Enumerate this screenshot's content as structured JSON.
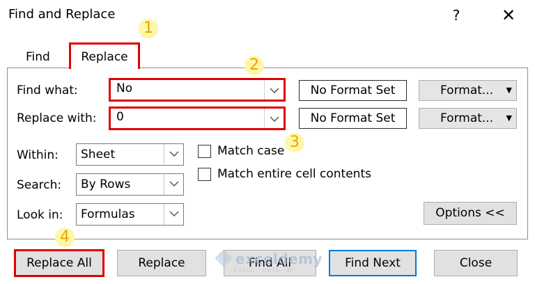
{
  "window": {
    "title": "Find and Replace",
    "help_glyph": "?",
    "close_glyph": "✕"
  },
  "tabs": [
    {
      "label": "Find"
    },
    {
      "label": "Replace"
    }
  ],
  "find_what": {
    "label": "Find what:",
    "value": "No",
    "format_status": "No Format Set",
    "format_button": "Format..."
  },
  "replace_with": {
    "label": "Replace with:",
    "value": "0",
    "format_status": "No Format Set",
    "format_button": "Format..."
  },
  "within": {
    "label": "Within:",
    "value": "Sheet"
  },
  "search": {
    "label": "Search:",
    "value": "By Rows"
  },
  "look_in": {
    "label": "Look in:",
    "value": "Formulas"
  },
  "options": {
    "match_case": {
      "label": "Match case",
      "checked": false
    },
    "match_entire": {
      "label": "Match entire cell contents",
      "checked": false
    },
    "options_button": "Options <<"
  },
  "buttons": {
    "replace_all": "Replace All",
    "replace": "Replace",
    "find_all": "Find All",
    "find_next": "Find Next",
    "close": "Close"
  },
  "annotations": [
    "1",
    "2",
    "3",
    "4"
  ],
  "watermark": {
    "name": "exceldemy",
    "tagline": "EXCEL · DATA · BI"
  },
  "colors": {
    "highlight_red": "#e00000",
    "annotation_bg": "#fff7a8",
    "annotation_text": "#e6a400",
    "default_button_border": "#0078d7"
  },
  "icons": {
    "dropdown": "chevron-down-icon",
    "format_dropdown": "triangle-down-icon"
  }
}
